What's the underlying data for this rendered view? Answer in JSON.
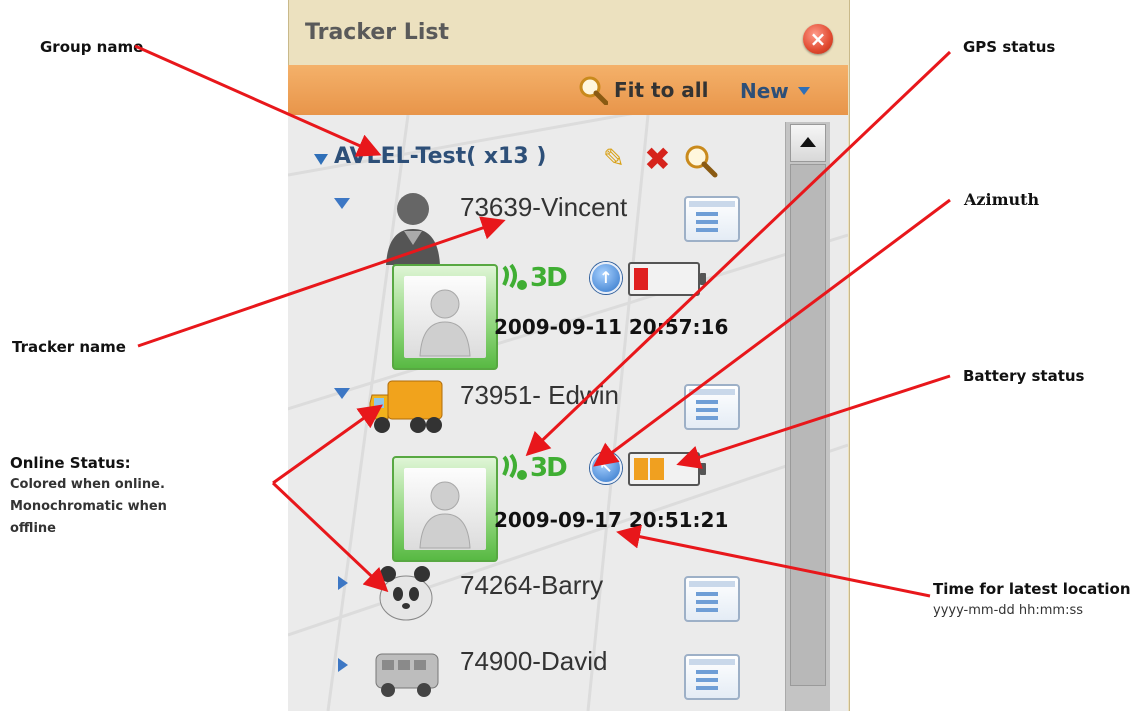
{
  "annotations": {
    "group_name": "Group name",
    "tracker_name": "Tracker name",
    "online_status_title": "Online Status:",
    "online_status_line1": "Colored when online.",
    "online_status_line2": "Monochromatic when",
    "online_status_line3": "offline",
    "gps_status": "GPS status",
    "azimuth": "Azimuth",
    "battery_status": "Battery status",
    "time_latest": "Time for latest location",
    "time_format": "yyyy-mm-dd    hh:mm:ss",
    "arrow_color": "#e8171b"
  },
  "panel": {
    "title": "Tracker List",
    "close_label": "×",
    "toolbar": {
      "fit_label": "Fit to all",
      "new_label": "New"
    },
    "group": {
      "name": "AVLEL-Test( x13 )"
    },
    "trackers": [
      {
        "name": "73639-Vincent",
        "expanded": true,
        "icon": "person-icon",
        "gps": "3D",
        "timestamp": "2009-09-11 20:57:16",
        "battery_level": 0.25,
        "battery_color": "#e02020"
      },
      {
        "name": "73951- Edwin",
        "expanded": true,
        "icon": "truck-icon",
        "gps": "3D",
        "timestamp": "2009-09-17 20:51:21",
        "battery_level": 0.5,
        "battery_color": "#f0a020"
      },
      {
        "name": "74264-Barry",
        "expanded": false,
        "icon": "panda-icon"
      },
      {
        "name": "74900-David",
        "expanded": false,
        "icon": "bus-icon"
      }
    ]
  }
}
